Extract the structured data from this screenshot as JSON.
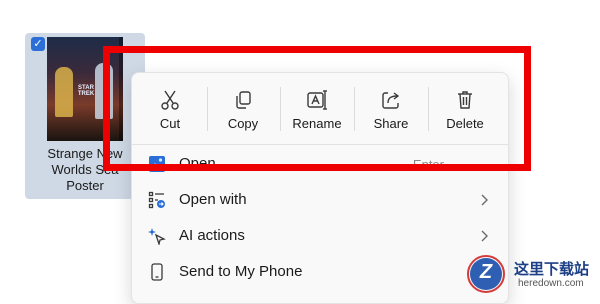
{
  "file": {
    "name_lines": [
      "Strange New",
      "Worlds Sea",
      "Poster"
    ],
    "thumbnail_title": "STAR TREK",
    "selected": true
  },
  "context_menu": {
    "quick_actions": [
      {
        "label": "Cut",
        "icon": "scissors-icon"
      },
      {
        "label": "Copy",
        "icon": "copy-icon"
      },
      {
        "label": "Rename",
        "icon": "rename-icon"
      },
      {
        "label": "Share",
        "icon": "share-icon"
      },
      {
        "label": "Delete",
        "icon": "trash-icon"
      }
    ],
    "items": [
      {
        "label": "Open",
        "shortcut": "Enter",
        "icon": "image-icon"
      },
      {
        "label": "Open with",
        "icon": "open-with-icon",
        "submenu": true
      },
      {
        "label": "AI actions",
        "icon": "ai-sparkle-icon",
        "submenu": true
      },
      {
        "label": "Send to My Phone",
        "icon": "phone-icon"
      }
    ]
  },
  "highlight": {
    "color": "#ee0000"
  },
  "watermark": {
    "text_cn": "这里下载站",
    "text_en": "heredown.com",
    "logo_letter": "Z"
  },
  "colors": {
    "accent": "#2b6fd6",
    "tile_selected": "#cfd9e6",
    "menu_bg": "#f9f9f9"
  }
}
